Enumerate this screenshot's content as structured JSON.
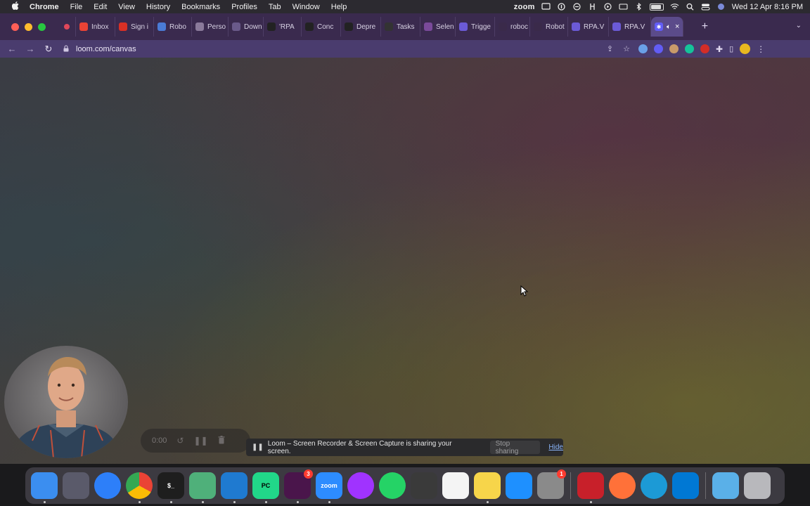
{
  "menubar": {
    "app_name": "Chrome",
    "menus": [
      "File",
      "Edit",
      "View",
      "History",
      "Bookmarks",
      "Profiles",
      "Tab",
      "Window",
      "Help"
    ],
    "zoom_label": "zoom",
    "clock": "Wed 12 Apr  8:16 PM"
  },
  "tabs": [
    {
      "label": "",
      "icon": "record-dot-icon",
      "color": "#e0475a"
    },
    {
      "label": "Inbox",
      "icon": "gmail-icon",
      "color": "#ea4335"
    },
    {
      "label": "Sign i",
      "icon": "c-logo-icon",
      "color": "#d93025"
    },
    {
      "label": "Robo",
      "icon": "calendar-icon",
      "color": "#4a7bd6"
    },
    {
      "label": "Perso",
      "icon": "feather-icon",
      "color": "#8a7a9a"
    },
    {
      "label": "Down",
      "icon": "download-icon",
      "color": "#6a5a8a"
    },
    {
      "label": "'RPA",
      "icon": "github-icon",
      "color": "#222"
    },
    {
      "label": "Conc",
      "icon": "github-icon",
      "color": "#222"
    },
    {
      "label": "Depre",
      "icon": "github-icon",
      "color": "#222"
    },
    {
      "label": "Tasks",
      "icon": "tasks-icon",
      "color": "#333"
    },
    {
      "label": "Selen",
      "icon": "selenium-icon",
      "color": "#7a4a9a"
    },
    {
      "label": "Trigge",
      "icon": "robocorp-icon",
      "color": "#6b5ad6"
    },
    {
      "label": "roboc",
      "icon": "robocorp-icon",
      "color": "#3a2a4a"
    },
    {
      "label": "Robot",
      "icon": "robocorp-icon",
      "color": "#3a2a4a"
    },
    {
      "label": "RPA.V",
      "icon": "robocorp-icon",
      "color": "#6b5ad6"
    },
    {
      "label": "RPA.V",
      "icon": "robocorp-icon",
      "color": "#6b5ad6"
    }
  ],
  "active_tab": {
    "icon": "loom-icon",
    "color": "#625df5"
  },
  "address": {
    "url": "loom.com/canvas"
  },
  "recording": {
    "timer": "0:00"
  },
  "share_banner": {
    "message": "Loom – Screen Recorder & Screen Capture is sharing your screen.",
    "stop_label": "Stop sharing",
    "hide_label": "Hide"
  },
  "dock": [
    {
      "name": "finder",
      "label": "",
      "color": "#3b8ef0",
      "running": true
    },
    {
      "name": "launchpad",
      "label": "",
      "color": "#5a5a6a",
      "running": false
    },
    {
      "name": "safari",
      "label": "",
      "color": "#2d7ff9",
      "running": false
    },
    {
      "name": "chrome",
      "label": "",
      "color": "#e8e8e8",
      "running": true
    },
    {
      "name": "terminal",
      "label": "$_",
      "color": "#1e1e1e",
      "running": true
    },
    {
      "name": "atom",
      "label": "",
      "color": "#4fb07a",
      "running": true
    },
    {
      "name": "vscode",
      "label": "",
      "color": "#1f7ad0",
      "running": true
    },
    {
      "name": "pycharm",
      "label": "PC",
      "color": "#21d789",
      "running": true
    },
    {
      "name": "slack",
      "label": "",
      "color": "#4a154b",
      "running": true,
      "badge": "3"
    },
    {
      "name": "zoom",
      "label": "zoom",
      "color": "#2d8cff",
      "running": true
    },
    {
      "name": "messenger",
      "label": "",
      "color": "#a033ff",
      "running": false
    },
    {
      "name": "whatsapp",
      "label": "",
      "color": "#25d366",
      "running": false
    },
    {
      "name": "calculator",
      "label": "",
      "color": "#3a3a3a",
      "running": false
    },
    {
      "name": "reminders",
      "label": "",
      "color": "#f4f4f4",
      "running": false
    },
    {
      "name": "notes",
      "label": "",
      "color": "#f7d54a",
      "running": true
    },
    {
      "name": "app-store",
      "label": "",
      "color": "#1e90ff",
      "running": false
    },
    {
      "name": "system-settings",
      "label": "",
      "color": "#8a8a8a",
      "running": false,
      "badge": "1"
    },
    {
      "name": "parallels",
      "label": "",
      "color": "#c8202a",
      "running": true
    },
    {
      "name": "firefox",
      "label": "",
      "color": "#ff7139",
      "running": false
    },
    {
      "name": "edge",
      "label": "",
      "color": "#1c9ad6",
      "running": false
    },
    {
      "name": "windows",
      "label": "",
      "color": "#0078d4",
      "running": false
    },
    {
      "name": "downloads-folder",
      "label": "",
      "color": "#5ab0e8",
      "running": false
    },
    {
      "name": "trash",
      "label": "",
      "color": "#b8b8bc",
      "running": false
    }
  ]
}
